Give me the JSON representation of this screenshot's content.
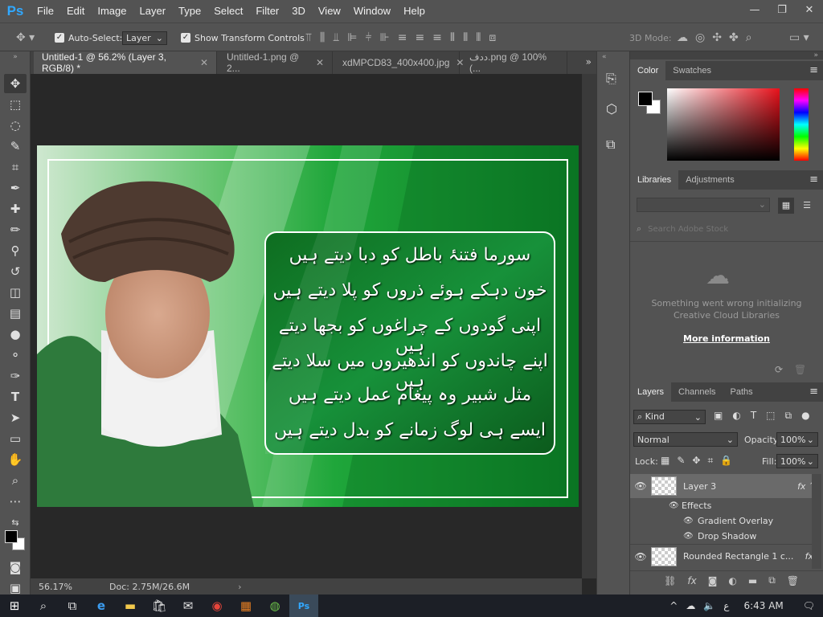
{
  "app": {
    "logo": "Ps"
  },
  "menu": [
    "File",
    "Edit",
    "Image",
    "Layer",
    "Type",
    "Select",
    "Filter",
    "3D",
    "View",
    "Window",
    "Help"
  ],
  "window_controls": {
    "minimize": "—",
    "restore": "❐",
    "close": "✕"
  },
  "options": {
    "auto_select_label": "Auto-Select:",
    "auto_select_value": "Layer",
    "show_transform_label": "Show Transform Controls",
    "mode_3d_label": "3D Mode:"
  },
  "tabs": [
    {
      "label": "Untitled-1 @ 56.2% (Layer 3, RGB/8) *",
      "close": "✕"
    },
    {
      "label": "Untitled-1.png @ 2...",
      "close": "✕"
    },
    {
      "label": "xdMPCD83_400x400.jpg",
      "close": "✕"
    },
    {
      "label": "ددف.png @ 100% (...",
      "close": "✕"
    }
  ],
  "document": {
    "poetry": [
      "سورما فتنۂ باطل کو دبا دیتے ہیں",
      "خون دہکے ہوئے ذروں کو پلا دیتے ہیں",
      "اپنی گودوں کے چراغوں کو بجھا دیتے ہیں",
      "اپنے چاندوں کو اندھیروں میں سلا دیتے ہیں",
      "مثل شبیر وہ پیغام عمل دیتے ہیں",
      "ایسے ہی لوگ زمانے کو بدل دیتے ہیں"
    ]
  },
  "status": {
    "zoom": "56.17%",
    "doc": "Doc: 2.75M/26.6M"
  },
  "color_panel": {
    "tabs": [
      "Color",
      "Swatches"
    ]
  },
  "libraries": {
    "tabs": [
      "Libraries",
      "Adjustments"
    ],
    "search_placeholder": "Search Adobe Stock",
    "error": "Something went wrong initializing Creative Cloud Libraries",
    "link": "More information"
  },
  "layers": {
    "tabs": [
      "Layers",
      "Channels",
      "Paths"
    ],
    "filter": "Kind",
    "blend": "Normal",
    "opacity_label": "Opacity:",
    "opacity": "100%",
    "lock_label": "Lock:",
    "fill_label": "Fill:",
    "fill": "100%",
    "items": [
      {
        "name": "Layer 3",
        "fx": "fx"
      },
      {
        "name": "Effects"
      },
      {
        "name": "Gradient Overlay"
      },
      {
        "name": "Drop Shadow"
      },
      {
        "name": "Rounded Rectangle 1 c...",
        "fx": "fx"
      }
    ]
  },
  "taskbar": {
    "time": "6:43 AM",
    "lang": "ع"
  },
  "colors": {
    "ps_blue": "#31a8ff",
    "panel": "#535353",
    "canvas_bg": "#282828",
    "doc_green": "#0c8a2a"
  }
}
